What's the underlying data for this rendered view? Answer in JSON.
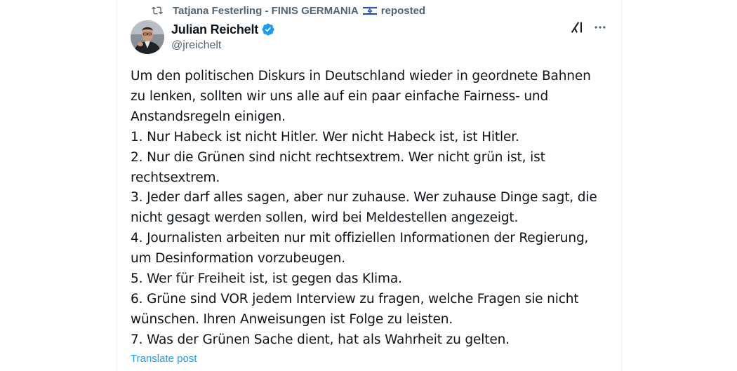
{
  "repost": {
    "reposter_name": "Tatjana Festerling - FINIS GERMANIA",
    "flag_icon": "israel-flag-icon",
    "suffix": "reposted",
    "icon": "repost-icon"
  },
  "author": {
    "display_name": "Julian Reichelt",
    "handle": "@jreichelt",
    "verified": true,
    "verified_color": "#1d9bf0"
  },
  "actions": {
    "grok_icon": "grok-icon",
    "more_icon": "more-options-icon"
  },
  "post": {
    "lines": [
      "Um den politischen Diskurs in Deutschland wieder in geordnete Bahnen",
      "zu lenken, sollten wir uns alle auf ein paar einfache Fairness- und",
      "Anstandsregeln einigen.",
      "1. Nur Habeck ist nicht Hitler. Wer nicht Habeck ist, ist Hitler.",
      "2. Nur die Grünen sind nicht rechtsextrem. Wer nicht grün ist, ist",
      "rechtsextrem.",
      "3. Jeder darf alles sagen, aber nur zuhause. Wer zuhause Dinge sagt, die",
      "nicht gesagt werden sollen, wird bei Meldestellen angezeigt.",
      "4. Journalisten arbeiten nur mit offiziellen Informationen der Regierung,",
      "um Desinformation vorzubeugen.",
      "5. Wer für Freiheit ist, ist gegen das Klima.",
      "6. Grüne sind VOR jedem Interview zu fragen, welche Fragen sie nicht",
      "wünschen. Ihren Anweisungen ist Folge zu leisten.",
      "7. Was der Grünen Sache dient, hat als Wahrheit zu gelten."
    ],
    "translate_label": "Translate post"
  },
  "colors": {
    "text_primary": "#0f1419",
    "text_secondary": "#536471",
    "link": "#1d9bf0"
  }
}
